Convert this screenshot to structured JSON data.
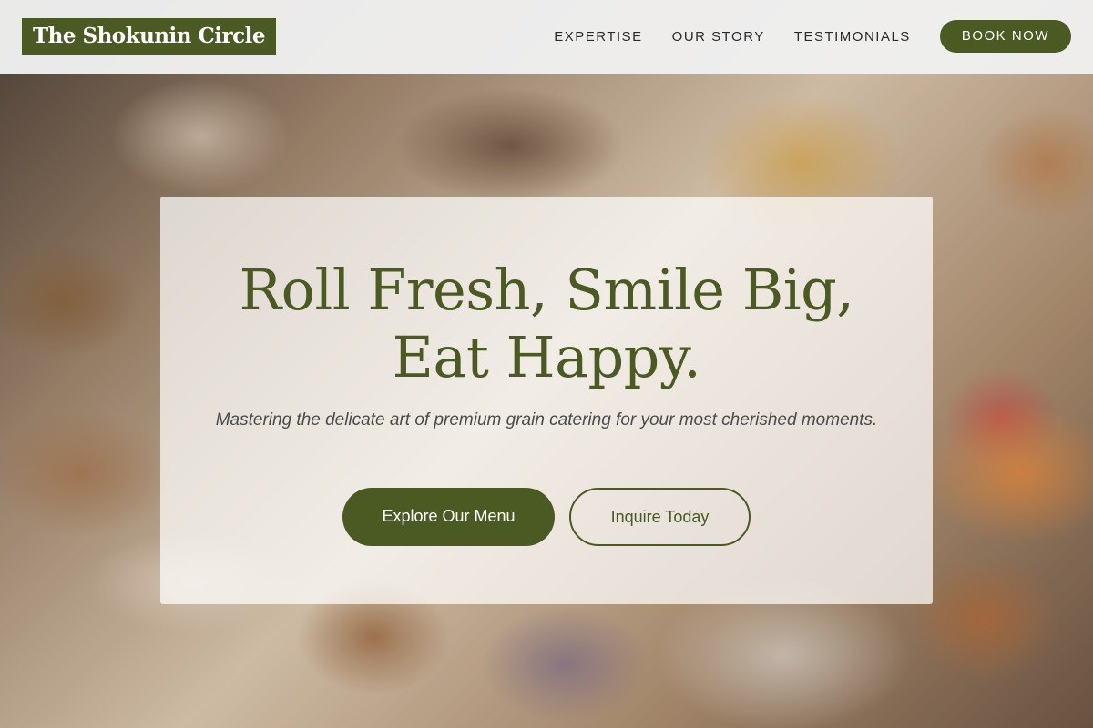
{
  "header": {
    "logo_text": "The Shokunin Circle",
    "nav_items": [
      {
        "label": "EXPERTISE"
      },
      {
        "label": "OUR STORY"
      },
      {
        "label": "TESTIMONIALS"
      }
    ],
    "cta_label": "BOOK NOW"
  },
  "hero": {
    "title_line1": "Roll Fresh, Smile Big,",
    "title_line2": "Eat Happy.",
    "subtitle": "Mastering the delicate art of premium grain catering for your most cherished moments.",
    "primary_button_label": "Explore Our Menu",
    "secondary_button_label": "Inquire Today"
  },
  "colors": {
    "brand": "#4a5a22",
    "header_bg": "#f0f0f0",
    "card_bg": "rgba(255,255,255,0.72)"
  }
}
